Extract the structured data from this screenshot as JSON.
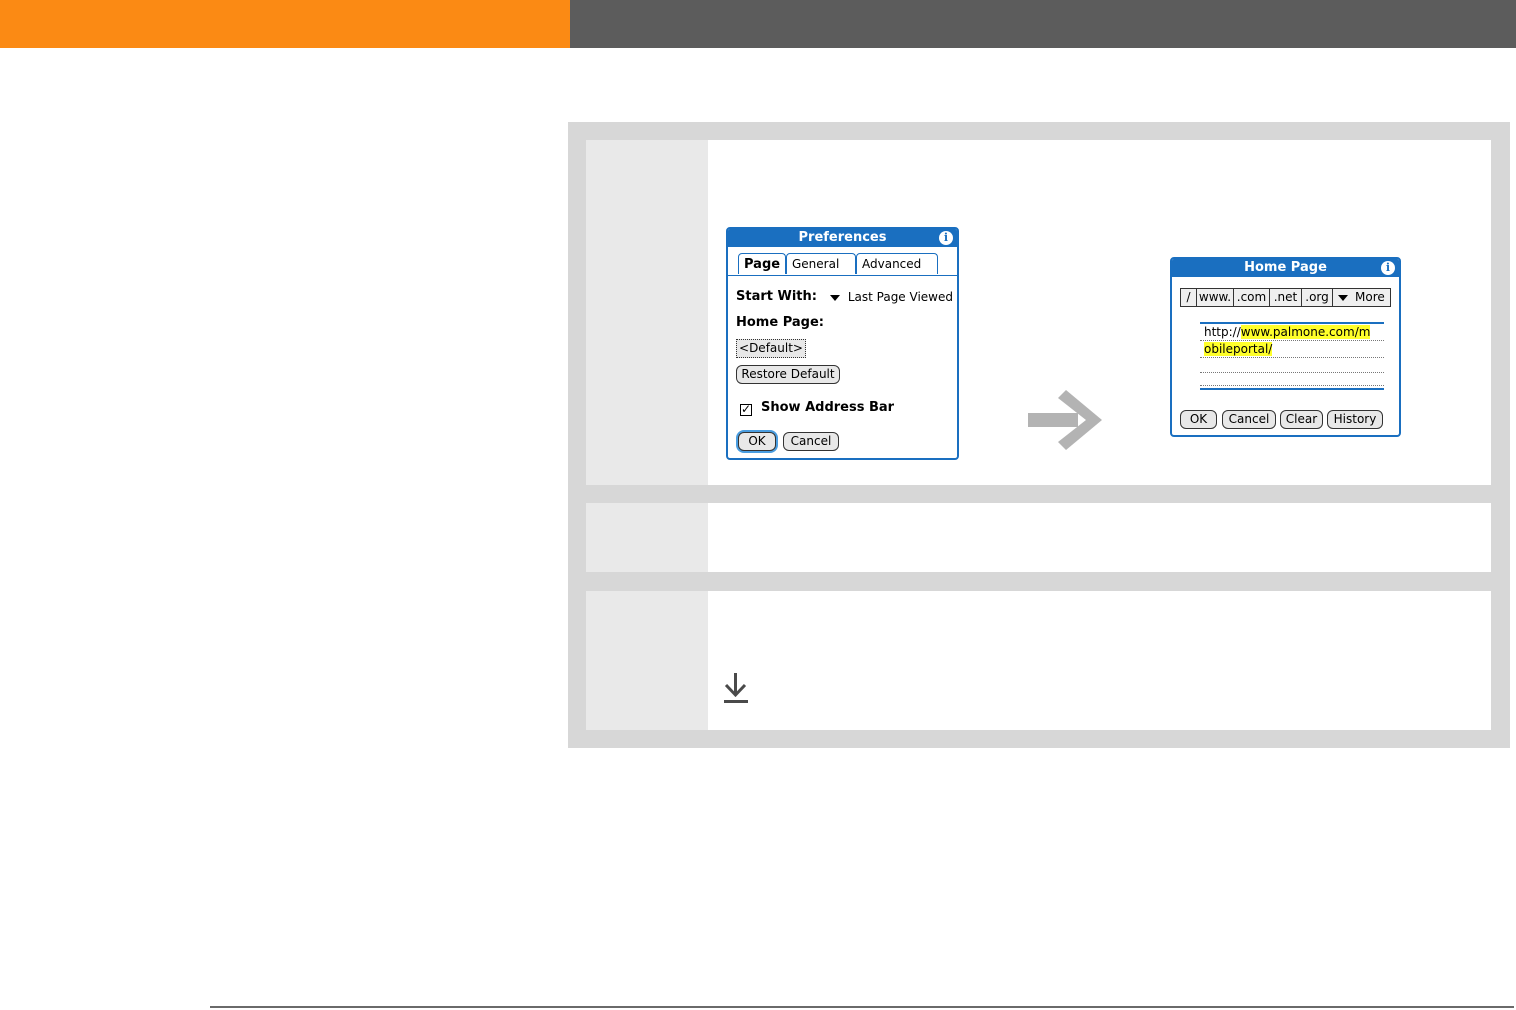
{
  "preferences_dialog": {
    "title": "Preferences",
    "tabs": [
      "Page",
      "General",
      "Advanced"
    ],
    "start_with_label": "Start With:",
    "start_with_value": "Last Page Viewed",
    "home_page_label": "Home Page:",
    "home_page_value": "<Default>",
    "restore_default_label": "Restore Default",
    "show_address_bar_label": "Show Address Bar",
    "show_address_bar_checked": true,
    "ok_label": "OK",
    "cancel_label": "Cancel"
  },
  "home_page_dialog": {
    "title": "Home Page",
    "shortcuts": [
      "/",
      "www.",
      ".com",
      ".net",
      ".org"
    ],
    "more_label": "More",
    "url_prefix": "http://",
    "url_line1_highlight": "www.palmone.com/m",
    "url_line2_highlight": "obileportal/",
    "ok_label": "OK",
    "cancel_label": "Cancel",
    "clear_label": "Clear",
    "history_label": "History"
  },
  "colors": {
    "header_orange": "#fb8a14",
    "header_gray": "#5c5c5c",
    "palm_blue": "#1a6fc0",
    "highlight_yellow": "#ffff2a"
  }
}
